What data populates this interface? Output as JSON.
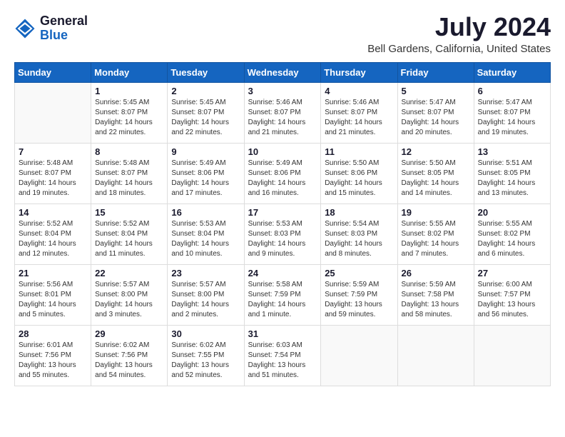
{
  "header": {
    "logo_general": "General",
    "logo_blue": "Blue",
    "month_title": "July 2024",
    "location": "Bell Gardens, California, United States"
  },
  "calendar": {
    "days_of_week": [
      "Sunday",
      "Monday",
      "Tuesday",
      "Wednesday",
      "Thursday",
      "Friday",
      "Saturday"
    ],
    "weeks": [
      [
        {
          "day": "",
          "sunrise": "",
          "sunset": "",
          "daylight": ""
        },
        {
          "day": "1",
          "sunrise": "Sunrise: 5:45 AM",
          "sunset": "Sunset: 8:07 PM",
          "daylight": "Daylight: 14 hours and 22 minutes."
        },
        {
          "day": "2",
          "sunrise": "Sunrise: 5:45 AM",
          "sunset": "Sunset: 8:07 PM",
          "daylight": "Daylight: 14 hours and 22 minutes."
        },
        {
          "day": "3",
          "sunrise": "Sunrise: 5:46 AM",
          "sunset": "Sunset: 8:07 PM",
          "daylight": "Daylight: 14 hours and 21 minutes."
        },
        {
          "day": "4",
          "sunrise": "Sunrise: 5:46 AM",
          "sunset": "Sunset: 8:07 PM",
          "daylight": "Daylight: 14 hours and 21 minutes."
        },
        {
          "day": "5",
          "sunrise": "Sunrise: 5:47 AM",
          "sunset": "Sunset: 8:07 PM",
          "daylight": "Daylight: 14 hours and 20 minutes."
        },
        {
          "day": "6",
          "sunrise": "Sunrise: 5:47 AM",
          "sunset": "Sunset: 8:07 PM",
          "daylight": "Daylight: 14 hours and 19 minutes."
        }
      ],
      [
        {
          "day": "7",
          "sunrise": "Sunrise: 5:48 AM",
          "sunset": "Sunset: 8:07 PM",
          "daylight": "Daylight: 14 hours and 19 minutes."
        },
        {
          "day": "8",
          "sunrise": "Sunrise: 5:48 AM",
          "sunset": "Sunset: 8:07 PM",
          "daylight": "Daylight: 14 hours and 18 minutes."
        },
        {
          "day": "9",
          "sunrise": "Sunrise: 5:49 AM",
          "sunset": "Sunset: 8:06 PM",
          "daylight": "Daylight: 14 hours and 17 minutes."
        },
        {
          "day": "10",
          "sunrise": "Sunrise: 5:49 AM",
          "sunset": "Sunset: 8:06 PM",
          "daylight": "Daylight: 14 hours and 16 minutes."
        },
        {
          "day": "11",
          "sunrise": "Sunrise: 5:50 AM",
          "sunset": "Sunset: 8:06 PM",
          "daylight": "Daylight: 14 hours and 15 minutes."
        },
        {
          "day": "12",
          "sunrise": "Sunrise: 5:50 AM",
          "sunset": "Sunset: 8:05 PM",
          "daylight": "Daylight: 14 hours and 14 minutes."
        },
        {
          "day": "13",
          "sunrise": "Sunrise: 5:51 AM",
          "sunset": "Sunset: 8:05 PM",
          "daylight": "Daylight: 14 hours and 13 minutes."
        }
      ],
      [
        {
          "day": "14",
          "sunrise": "Sunrise: 5:52 AM",
          "sunset": "Sunset: 8:04 PM",
          "daylight": "Daylight: 14 hours and 12 minutes."
        },
        {
          "day": "15",
          "sunrise": "Sunrise: 5:52 AM",
          "sunset": "Sunset: 8:04 PM",
          "daylight": "Daylight: 14 hours and 11 minutes."
        },
        {
          "day": "16",
          "sunrise": "Sunrise: 5:53 AM",
          "sunset": "Sunset: 8:04 PM",
          "daylight": "Daylight: 14 hours and 10 minutes."
        },
        {
          "day": "17",
          "sunrise": "Sunrise: 5:53 AM",
          "sunset": "Sunset: 8:03 PM",
          "daylight": "Daylight: 14 hours and 9 minutes."
        },
        {
          "day": "18",
          "sunrise": "Sunrise: 5:54 AM",
          "sunset": "Sunset: 8:03 PM",
          "daylight": "Daylight: 14 hours and 8 minutes."
        },
        {
          "day": "19",
          "sunrise": "Sunrise: 5:55 AM",
          "sunset": "Sunset: 8:02 PM",
          "daylight": "Daylight: 14 hours and 7 minutes."
        },
        {
          "day": "20",
          "sunrise": "Sunrise: 5:55 AM",
          "sunset": "Sunset: 8:02 PM",
          "daylight": "Daylight: 14 hours and 6 minutes."
        }
      ],
      [
        {
          "day": "21",
          "sunrise": "Sunrise: 5:56 AM",
          "sunset": "Sunset: 8:01 PM",
          "daylight": "Daylight: 14 hours and 5 minutes."
        },
        {
          "day": "22",
          "sunrise": "Sunrise: 5:57 AM",
          "sunset": "Sunset: 8:00 PM",
          "daylight": "Daylight: 14 hours and 3 minutes."
        },
        {
          "day": "23",
          "sunrise": "Sunrise: 5:57 AM",
          "sunset": "Sunset: 8:00 PM",
          "daylight": "Daylight: 14 hours and 2 minutes."
        },
        {
          "day": "24",
          "sunrise": "Sunrise: 5:58 AM",
          "sunset": "Sunset: 7:59 PM",
          "daylight": "Daylight: 14 hours and 1 minute."
        },
        {
          "day": "25",
          "sunrise": "Sunrise: 5:59 AM",
          "sunset": "Sunset: 7:59 PM",
          "daylight": "Daylight: 13 hours and 59 minutes."
        },
        {
          "day": "26",
          "sunrise": "Sunrise: 5:59 AM",
          "sunset": "Sunset: 7:58 PM",
          "daylight": "Daylight: 13 hours and 58 minutes."
        },
        {
          "day": "27",
          "sunrise": "Sunrise: 6:00 AM",
          "sunset": "Sunset: 7:57 PM",
          "daylight": "Daylight: 13 hours and 56 minutes."
        }
      ],
      [
        {
          "day": "28",
          "sunrise": "Sunrise: 6:01 AM",
          "sunset": "Sunset: 7:56 PM",
          "daylight": "Daylight: 13 hours and 55 minutes."
        },
        {
          "day": "29",
          "sunrise": "Sunrise: 6:02 AM",
          "sunset": "Sunset: 7:56 PM",
          "daylight": "Daylight: 13 hours and 54 minutes."
        },
        {
          "day": "30",
          "sunrise": "Sunrise: 6:02 AM",
          "sunset": "Sunset: 7:55 PM",
          "daylight": "Daylight: 13 hours and 52 minutes."
        },
        {
          "day": "31",
          "sunrise": "Sunrise: 6:03 AM",
          "sunset": "Sunset: 7:54 PM",
          "daylight": "Daylight: 13 hours and 51 minutes."
        },
        {
          "day": "",
          "sunrise": "",
          "sunset": "",
          "daylight": ""
        },
        {
          "day": "",
          "sunrise": "",
          "sunset": "",
          "daylight": ""
        },
        {
          "day": "",
          "sunrise": "",
          "sunset": "",
          "daylight": ""
        }
      ]
    ]
  }
}
